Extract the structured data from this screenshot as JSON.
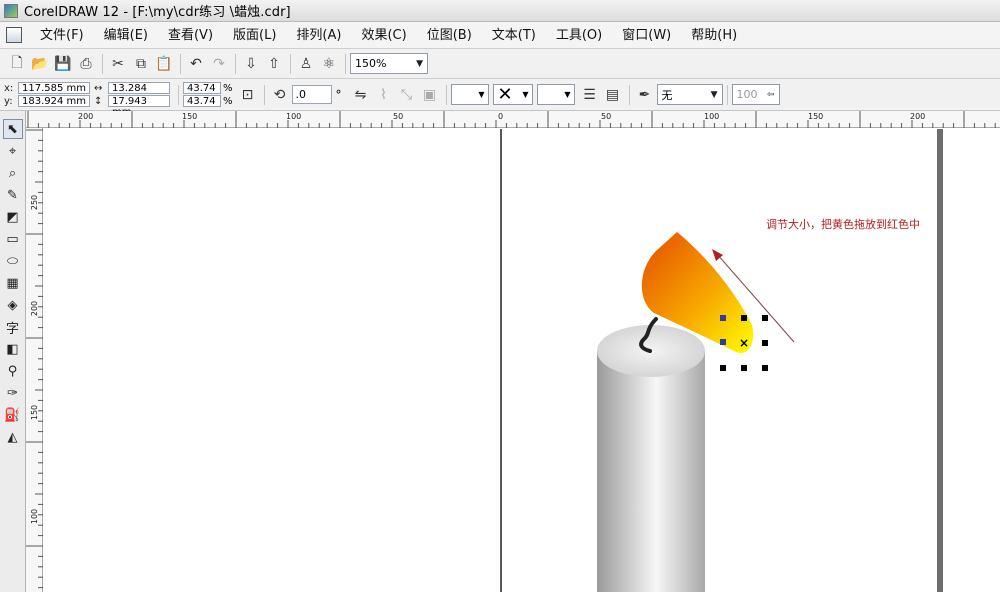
{
  "window": {
    "title": "CorelDRAW 12 - [F:\\my\\cdr练习  \\蜡烛.cdr]"
  },
  "menu": [
    {
      "label": "文件(F)"
    },
    {
      "label": "编辑(E)"
    },
    {
      "label": "查看(V)"
    },
    {
      "label": "版面(L)"
    },
    {
      "label": "排列(A)"
    },
    {
      "label": "效果(C)"
    },
    {
      "label": "位图(B)"
    },
    {
      "label": "文本(T)"
    },
    {
      "label": "工具(O)"
    },
    {
      "label": "窗口(W)"
    },
    {
      "label": "帮助(H)"
    }
  ],
  "toolbar": {
    "zoom": "150%"
  },
  "propbar": {
    "x_label": "x:",
    "x": "117.585 mm",
    "y_label": "y:",
    "y": "183.924 mm",
    "w": "13.284 mm",
    "h": "17.943 mm",
    "sx": "43.74",
    "sy": "43.74",
    "pct": "%",
    "rotation": ".0",
    "deg": "°",
    "outline": "无",
    "outline_width": "100"
  },
  "ruler": {
    "top": [
      "200",
      "150",
      "100",
      "50",
      "0",
      "50",
      "100",
      "150",
      "200"
    ],
    "left": [
      "250",
      "200",
      "150",
      "100"
    ]
  },
  "annotation": "调节大小，把黄色拖放到红色中",
  "colors": {
    "flame_start": "#e34b00",
    "flame_end": "#ffff00",
    "arrow": "#b32020"
  },
  "icons": {
    "tools": [
      "pick-tool-icon",
      "shape-tool-icon",
      "zoom-tool-icon",
      "freehand-tool-icon",
      "smart-fill-icon",
      "rectangle-tool-icon",
      "ellipse-tool-icon",
      "polygon-tool-icon",
      "basic-shapes-icon",
      "text-tool-icon",
      "interactive-blend-icon",
      "eyedropper-icon",
      "outline-tool-icon",
      "fill-tool-icon",
      "interactive-fill-icon"
    ]
  }
}
